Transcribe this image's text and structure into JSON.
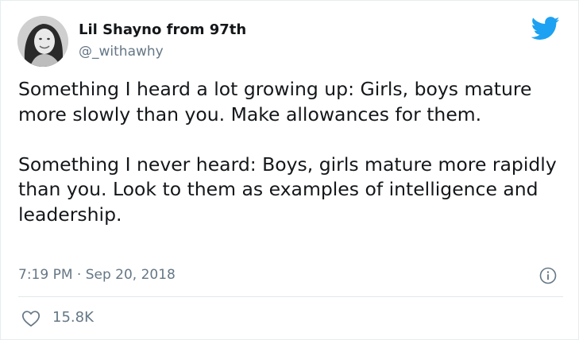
{
  "tweet": {
    "author": {
      "display_name": "Lil Shayno from 97th",
      "handle": "@_withawhy",
      "avatar_icon": "profile-photo"
    },
    "logo_icon": "twitter-bird-icon",
    "text_paragraphs": [
      "Something I heard a lot growing up: Girls, boys mature more slowly than you. Make allowances for them.",
      "Something I never heard: Boys, girls mature more rapidly than you. Look to them as examples of intelligence and leadership."
    ],
    "timestamp": "7:19 PM · Sep 20, 2018",
    "info_icon": "info-icon",
    "likes": {
      "icon": "heart-icon",
      "count": "15.8K"
    }
  },
  "colors": {
    "brand_blue": "#1da1f2",
    "text_primary": "#14171a",
    "text_secondary": "#657786",
    "divider": "#e1e8ed"
  }
}
